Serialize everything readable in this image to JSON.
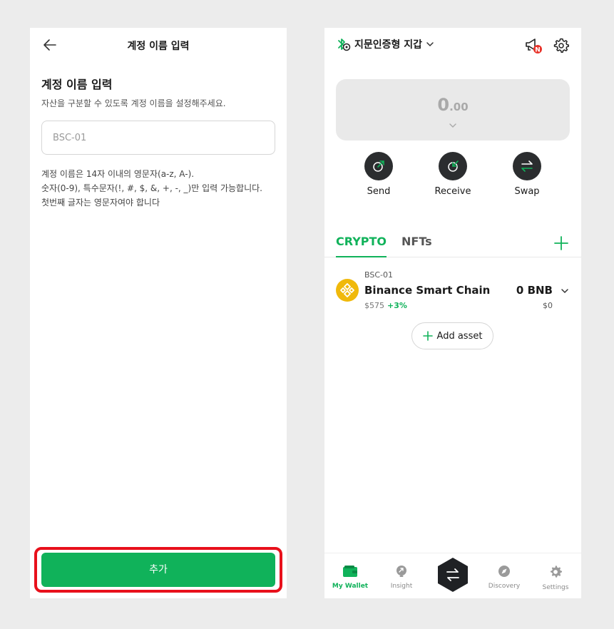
{
  "left_screen": {
    "title": "계정 이름 입력",
    "heading": "계정 이름 입력",
    "subtext": "자산을 구분할 수 있도록 계정 이름을 설정해주세요.",
    "input_placeholder": "BSC-01",
    "rules": [
      "계정 이름은 14자 이내의 영문자(a-z, A-).",
      "숫자(0-9), 특수문자(!, #, $, &, +, -, _)만 입력 가능합니다.",
      "첫번째 글자는 영문자여야 합니다"
    ],
    "add_button": "추가",
    "highlight_color": "#e8101b"
  },
  "right_screen": {
    "wallet_name": "지문인증형 지갑",
    "notification_badge": "N",
    "balance_int": "0",
    "balance_dec": ".00",
    "actions": [
      {
        "label": "Send",
        "icon": "send-icon"
      },
      {
        "label": "Receive",
        "icon": "receive-icon"
      },
      {
        "label": "Swap",
        "icon": "swap-icon"
      }
    ],
    "tabs": [
      "CRYPTO",
      "NFTs"
    ],
    "asset": {
      "account": "BSC-01",
      "chain": "Binance Smart Chain",
      "price": "$575",
      "change": "+3%",
      "amount": "0 BNB",
      "fiat": "$0"
    },
    "add_asset": "Add asset",
    "nav": [
      {
        "label": "My Wallet",
        "icon": "wallet-icon",
        "active": true
      },
      {
        "label": "Insight",
        "icon": "insight-icon"
      },
      {
        "label": "Discovery",
        "icon": "compass-icon"
      },
      {
        "label": "Settings",
        "icon": "settings-icon"
      }
    ]
  },
  "colors": {
    "accent_green": "#10b25a",
    "dark": "#2b2d2f",
    "bnb_yellow": "#f0b90b"
  }
}
